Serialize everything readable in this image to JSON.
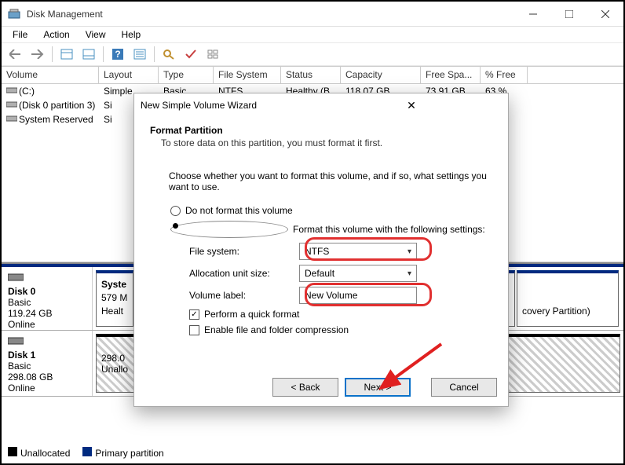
{
  "title": "Disk Management",
  "menu": {
    "file": "File",
    "action": "Action",
    "view": "View",
    "help": "Help"
  },
  "columns": {
    "volume": "Volume",
    "layout": "Layout",
    "type": "Type",
    "fs": "File System",
    "status": "Status",
    "capacity": "Capacity",
    "free": "Free Spa...",
    "pct": "% Free"
  },
  "rows": [
    {
      "volume": "(C:)",
      "layout": "Simple",
      "type": "Basic",
      "fs": "NTFS",
      "status": "Healthy (B...",
      "capacity": "118.07 GB",
      "free": "73.91 GB",
      "pct": "63 %"
    },
    {
      "volume": "(Disk 0 partition 3)",
      "layout": "Si",
      "type": "",
      "fs": "",
      "status": "",
      "capacity": "",
      "free": "",
      "pct": ""
    },
    {
      "volume": "System Reserved",
      "layout": "Si",
      "type": "",
      "fs": "",
      "status": "",
      "capacity": "",
      "free": "",
      "pct": ""
    }
  ],
  "disks": [
    {
      "name": "Disk 0",
      "type": "Basic",
      "size": "119.24 GB",
      "state": "Online",
      "parts": [
        {
          "title": "Syste",
          "size": "579 M",
          "health": "Healt"
        },
        {
          "title": "",
          "size": "",
          "health": ""
        },
        {
          "title": "",
          "size": "",
          "health": "covery Partition)"
        }
      ]
    },
    {
      "name": "Disk 1",
      "type": "Basic",
      "size": "298.08 GB",
      "state": "Online",
      "parts": [
        {
          "title": "",
          "size": "298.0",
          "health": "Unallo"
        }
      ]
    }
  ],
  "legend": {
    "unallocated": "Unallocated",
    "primary": "Primary partition"
  },
  "wizard": {
    "title": "New Simple Volume Wizard",
    "heading": "Format Partition",
    "sub": "To store data on this partition, you must format it first.",
    "instr": "Choose whether you want to format this volume, and if so, what settings you want to use.",
    "radio_noformat": "Do not format this volume",
    "radio_format": "Format this volume with the following settings:",
    "fs_label": "File system:",
    "fs_value": "NTFS",
    "au_label": "Allocation unit size:",
    "au_value": "Default",
    "vl_label": "Volume label:",
    "vl_value": "New Volume",
    "chk_quick": "Perform a quick format",
    "chk_compress": "Enable file and folder compression",
    "back": "< Back",
    "next": "Next >",
    "cancel": "Cancel"
  }
}
